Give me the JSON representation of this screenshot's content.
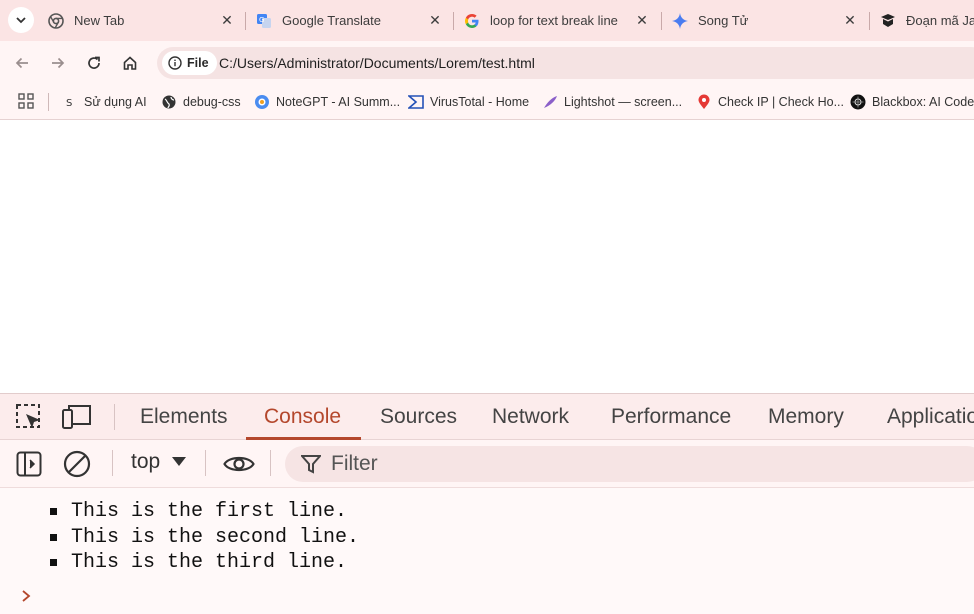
{
  "browser": {
    "tabs": [
      {
        "title": "New Tab",
        "icon": "chrome-icon"
      },
      {
        "title": "Google Translate",
        "icon": "google-translate-icon"
      },
      {
        "title": "loop for text break line ad",
        "icon": "google-icon"
      },
      {
        "title": "Song Tử",
        "icon": "gemini-icon"
      },
      {
        "title": "Đoạn mã Java",
        "icon": "book-icon"
      }
    ],
    "address": {
      "chip_label": "File",
      "url": "C:/Users/Administrator/Documents/Lorem/test.html"
    },
    "bookmarks": [
      {
        "label": "Sử dụng AI",
        "icon": "s-letter-icon"
      },
      {
        "label": "debug-css",
        "icon": "globe-icon"
      },
      {
        "label": "NoteGPT - AI Summ...",
        "icon": "notegpt-icon"
      },
      {
        "label": "VirusTotal - Home",
        "icon": "virustotal-icon"
      },
      {
        "label": "Lightshot — screen...",
        "icon": "feather-icon"
      },
      {
        "label": "Check IP | Check Ho...",
        "icon": "location-pin-icon"
      },
      {
        "label": "Blackbox: AI Code G",
        "icon": "blackbox-icon"
      }
    ]
  },
  "devtools": {
    "tabs": [
      "Elements",
      "Console",
      "Sources",
      "Network",
      "Performance",
      "Memory",
      "Applicatio"
    ],
    "active_tab": "Console",
    "context": "top",
    "filter_placeholder": "Filter",
    "console_lines": [
      "This is the first line.",
      "This is the second line.",
      "This is the third line."
    ],
    "accent_color": "#b4472c"
  }
}
